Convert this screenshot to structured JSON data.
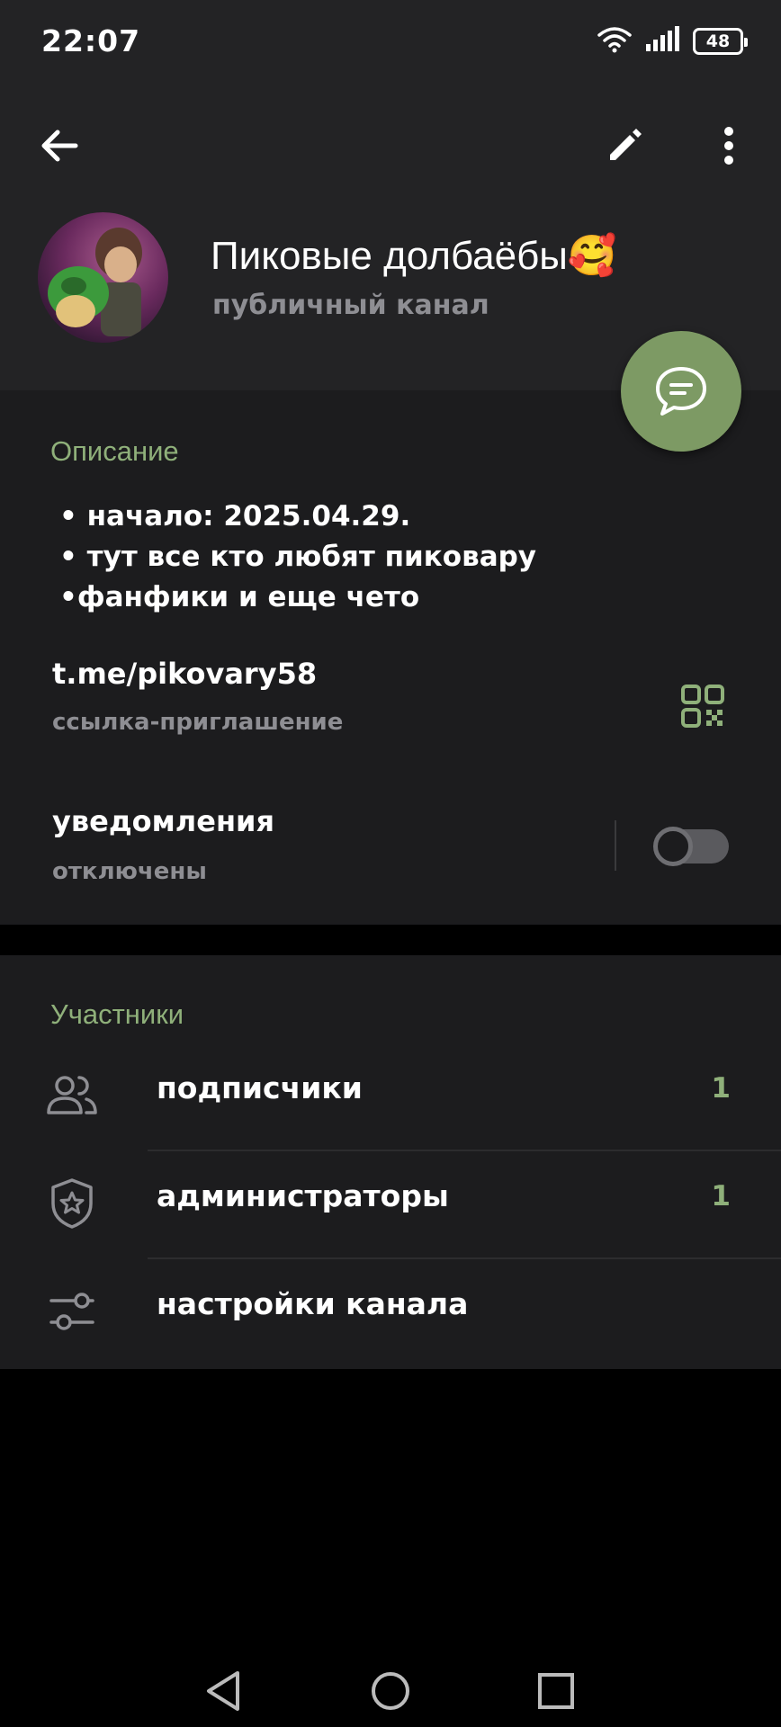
{
  "status_bar": {
    "time": "22:07",
    "battery": "48"
  },
  "header": {
    "channel_name": "Пиковые долбаёбы🥰",
    "channel_type": "публичный канал"
  },
  "description_section": {
    "label": "Описание",
    "lines": [
      "• начало: 2025.04.29.",
      "• тут все кто любят пиковару",
      "•фанфики и еще чето"
    ]
  },
  "invite_link": {
    "link": "t.me/pikovary58",
    "sub": "ссылка-приглашение"
  },
  "notifications": {
    "label": "уведомления",
    "sub": "отключены",
    "enabled": false
  },
  "members_section": {
    "label": "Участники",
    "items": [
      {
        "label": "подписчики",
        "count": "1",
        "icon": "people-icon"
      },
      {
        "label": "администраторы",
        "count": "1",
        "icon": "shield-star-icon"
      },
      {
        "label": "настройки канала",
        "count": "",
        "icon": "sliders-icon"
      }
    ]
  },
  "colors": {
    "accent": "#8fb07a",
    "fab": "#7d9a64",
    "header_bg": "#232325",
    "section_bg": "#1c1c1e",
    "secondary_text": "#8e8e93"
  }
}
